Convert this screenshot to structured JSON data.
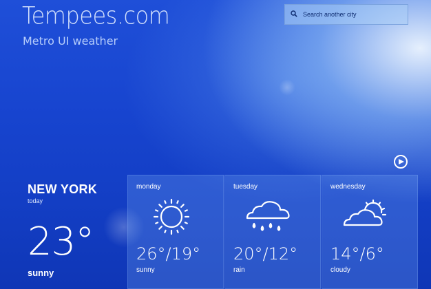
{
  "header": {
    "site_title": "Tempees.com",
    "subtitle": "Metro UI weather"
  },
  "search": {
    "placeholder": "Search another city",
    "icon": "search-icon"
  },
  "navigation": {
    "next_icon": "play-circle-icon"
  },
  "today": {
    "city": "NEW YORK",
    "day_label": "today",
    "temperature": "23°",
    "condition": "sunny"
  },
  "forecast": [
    {
      "day": "monday",
      "temps": "26°/19°",
      "condition": "sunny",
      "icon": "sun-icon"
    },
    {
      "day": "tuesday",
      "temps": "20°/12°",
      "condition": "rain",
      "icon": "rain-cloud-icon"
    },
    {
      "day": "wednesday",
      "temps": "14°/6°",
      "condition": "cloudy",
      "icon": "partly-cloudy-icon"
    }
  ],
  "colors": {
    "background_top": "#1f4fd8",
    "background_bottom": "#0f36b6",
    "text": "#ffffff"
  }
}
